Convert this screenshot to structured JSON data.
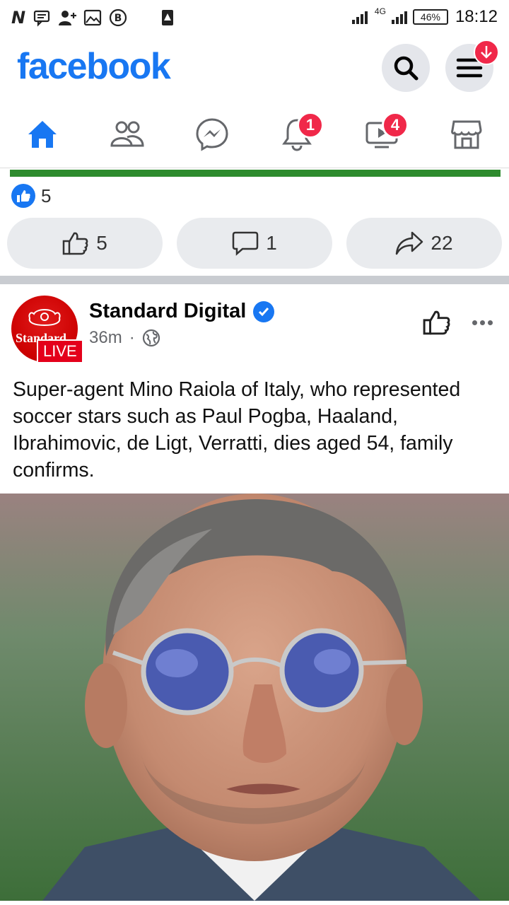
{
  "status_bar": {
    "carrier_icon": "N",
    "network": "4G",
    "battery": "46%",
    "time": "18:12"
  },
  "header": {
    "logo": "facebook",
    "search_icon": "search-icon",
    "menu_icon": "menu-icon"
  },
  "nav": {
    "items": [
      {
        "name": "home",
        "icon": "home-icon",
        "active": true,
        "badge": ""
      },
      {
        "name": "friends",
        "icon": "friends-icon",
        "badge": ""
      },
      {
        "name": "messenger",
        "icon": "messenger-icon",
        "badge": ""
      },
      {
        "name": "notifications",
        "icon": "bell-icon",
        "badge": "1"
      },
      {
        "name": "watch",
        "icon": "video-icon",
        "badge": "4"
      },
      {
        "name": "marketplace",
        "icon": "store-icon",
        "badge": ""
      }
    ]
  },
  "previous_post": {
    "reaction_count": "5",
    "like_count": "5",
    "comment_count": "1",
    "share_count": "22"
  },
  "post": {
    "page_name": "Standard Digital",
    "avatar_text": "Standard",
    "live_label": "LIVE",
    "time": "36m",
    "separator": "·",
    "text": "Super-agent Mino Raiola of Italy, who represented soccer stars such as Paul Pogba, Haaland, Ibrahimovic, de Ligt, Verratti, dies aged 54, family confirms."
  },
  "colors": {
    "brand": "#1877f2",
    "badge": "#f02849",
    "live": "#e4001b"
  }
}
